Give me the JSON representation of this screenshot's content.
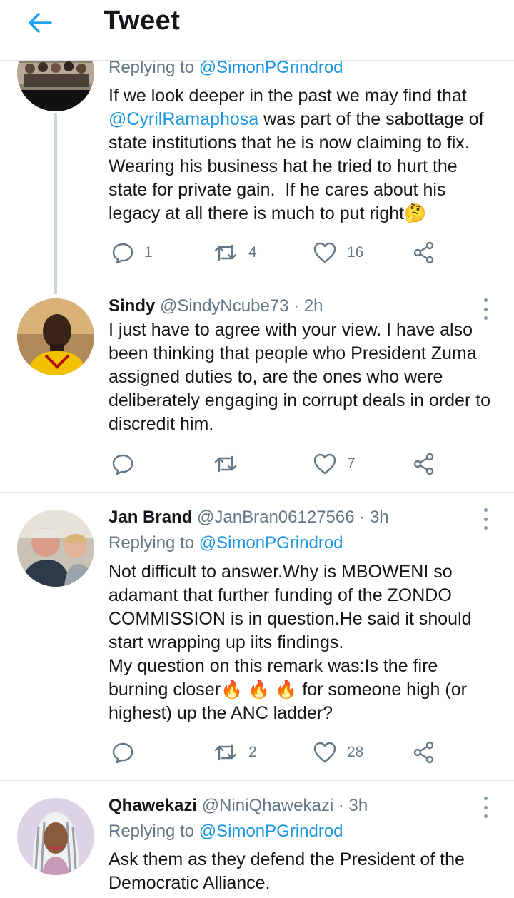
{
  "header": {
    "title": "Tweet"
  },
  "tweets": [
    {
      "replying_prefix": "Replying to ",
      "replying_to": "@SimonPGrindrod",
      "body_mention": "@CyrilRamaphosa",
      "body_lines": [
        "If we look deeper in the past we may find that",
        " was part of the sabottage of",
        "state institutions that he is now claiming to fix.",
        "Wearing his business hat he tried to hurt the",
        "state for private gain.  If he cares about his",
        "legacy at all there is much to put right🤔"
      ],
      "reply_count": "1",
      "retweet_count": "4",
      "like_count": "16"
    },
    {
      "name": "Sindy",
      "handle": "@SindyNcube73",
      "dot": "·",
      "time": "2h",
      "body": "I just have to agree with your view. I have also been thinking that people who President Zuma assigned duties to, are the ones who were deliberately engaging in corrupt deals in order to discredit him.",
      "reply_count": "",
      "retweet_count": "",
      "like_count": "7"
    },
    {
      "name": "Jan Brand",
      "handle": "@JanBran06127566",
      "dot": "·",
      "time": "3h",
      "replying_prefix": "Replying to ",
      "replying_to": "@SimonPGrindrod",
      "body": "Not difficult to answer.Why is MBOWENI so adamant that further funding of the ZONDO COMMISSION is in question.He said it should start wrapping up iits findings.\nMy question on this remark was:Is the fire burning closer🔥 🔥 🔥 for someone high (or highest) up the ANC ladder?",
      "reply_count": "",
      "retweet_count": "2",
      "like_count": "28"
    },
    {
      "name": "Qhawekazi",
      "handle": "@NiniQhawekazi",
      "dot": "·",
      "time": "3h",
      "replying_prefix": "Replying to ",
      "replying_to": "@SimonPGrindrod",
      "body": "Ask them as they defend the President of the Democratic Alliance."
    }
  ]
}
